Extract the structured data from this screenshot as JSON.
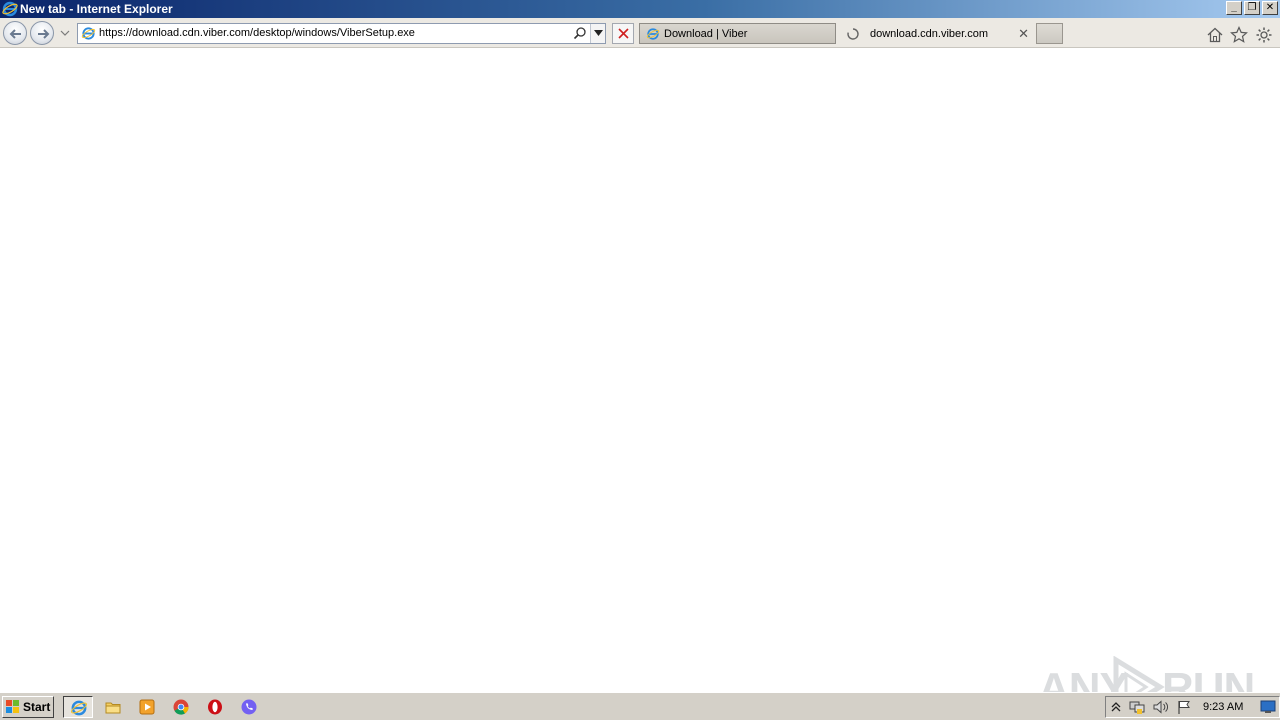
{
  "window": {
    "title": "New tab - Internet Explorer",
    "minimize_glyph": "_",
    "restore_glyph": "❐",
    "close_glyph": "✕"
  },
  "address_bar": {
    "url": "https://download.cdn.viber.com/desktop/windows/ViberSetup.exe"
  },
  "tabs": [
    {
      "label": "Download | Viber",
      "icon": "ie-page-icon"
    },
    {
      "label": "download.cdn.viber.com",
      "icon": "loading-spinner-icon",
      "close": "✕"
    }
  ],
  "toolbar_icons": [
    "home-icon",
    "star-icon",
    "gear-icon"
  ],
  "watermark": {
    "left": "ANY",
    "right": "RUN"
  },
  "taskbar": {
    "start_label": "Start",
    "items": [
      "internet-explorer-icon",
      "file-explorer-icon",
      "media-player-icon",
      "chrome-icon",
      "opera-icon",
      "viber-icon"
    ],
    "clock": "9:23 AM"
  },
  "colors": {
    "titlebar_start": "#0a246a",
    "titlebar_end": "#a6caf0",
    "taskbar": "#d4d0c8",
    "viber_purple": "#7360f2",
    "stop_red": "#d02020"
  }
}
